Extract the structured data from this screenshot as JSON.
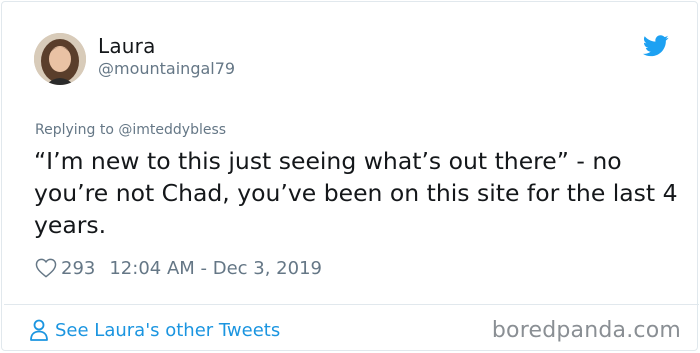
{
  "user": {
    "name": "Laura",
    "handle": "@mountaingal79"
  },
  "tweet": {
    "replying_to": "Replying to @imteddybless",
    "text": "“I’m new to this just seeing what’s out there” - no you’re not Chad, you’ve been on this site for the last 4 years.",
    "likes": "293",
    "timestamp": "12:04 AM - Dec 3, 2019"
  },
  "footer": {
    "see_more_label": "See Laura's other Tweets",
    "source": "boredpanda.com"
  },
  "icons": {
    "brand": "twitter-bird-icon",
    "like": "heart-icon",
    "profile": "person-icon"
  },
  "colors": {
    "twitter_blue": "#1da1f2",
    "link_blue": "#1b95e0",
    "secondary_text": "#657786",
    "primary_text": "#14171a"
  }
}
